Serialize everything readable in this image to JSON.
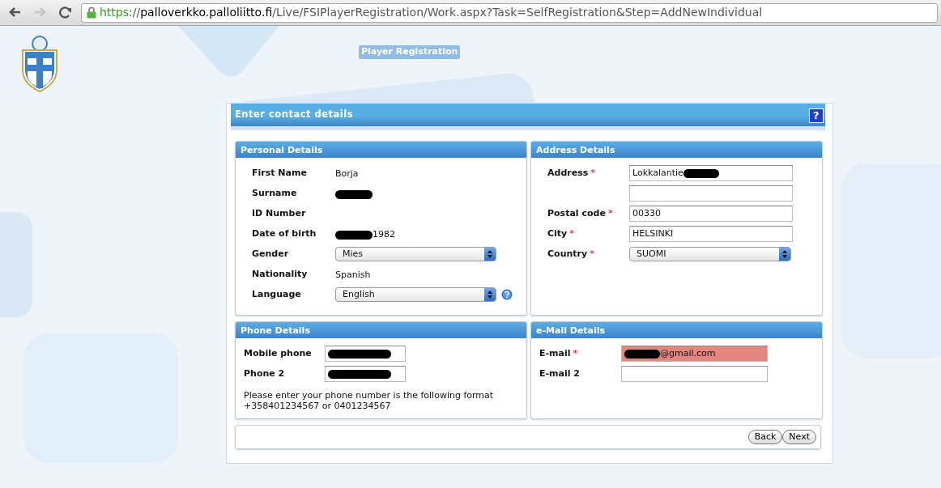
{
  "browser": {
    "nav_buttons": [
      {
        "kind": "back",
        "disabled": false
      },
      {
        "kind": "forward",
        "disabled": true
      },
      {
        "kind": "reload",
        "disabled": false
      }
    ],
    "url": {
      "scheme": "https",
      "separator": "://",
      "host": "palloverkko.palloliitto.fi",
      "path": "/Live/FSIPlayerRegistration/Work.aspx?Task=SelfRegistration&Step=AddNewIndividual"
    }
  },
  "header": {
    "title": "Player Registration"
  },
  "form": {
    "title": "Enter contact details",
    "help_label": "?",
    "sections": [
      {
        "title": "Personal Details",
        "rows": [
          {
            "label": "First Name",
            "kind": "text",
            "value": "Borja"
          },
          {
            "label": "Surname",
            "kind": "text",
            "redacted_before": true
          },
          {
            "label": "ID Number",
            "kind": "text"
          },
          {
            "label": "Date of birth",
            "kind": "text",
            "value": "1982",
            "redacted_before": true
          },
          {
            "label": "Gender",
            "kind": "select",
            "value": "Mies"
          },
          {
            "label": "Nationality",
            "kind": "text",
            "value": "Spanish"
          },
          {
            "label": "Language",
            "kind": "select",
            "value": "English",
            "help": true
          }
        ]
      },
      {
        "title": "Address Details",
        "rows": [
          {
            "label": "Address",
            "required_mark": "*",
            "kind": "input",
            "value": "Lokkalantie",
            "redacted_after": true
          },
          {
            "kind": "input"
          },
          {
            "label": "Postal code",
            "required_mark": "*",
            "kind": "input",
            "value": "00330"
          },
          {
            "label": "City",
            "required_mark": "*",
            "kind": "input",
            "value": "HELSINKI"
          },
          {
            "label": "Country",
            "required_mark": "*",
            "kind": "select",
            "value": "SUOMI"
          }
        ]
      },
      {
        "title": "Phone Details",
        "rows": [
          {
            "label": "Mobile phone",
            "kind": "input",
            "redacted_before": true
          },
          {
            "label": "Phone 2",
            "kind": "input",
            "redacted_before": true
          }
        ],
        "note_lines": [
          "Please enter your phone number is the following format",
          "+358401234567 or 0401234567"
        ]
      },
      {
        "title": "e-Mail Details",
        "rows": [
          {
            "label": "E-mail",
            "required_mark": "*",
            "kind": "input",
            "value": "@gmail.com",
            "redacted_before": true,
            "invalid": true
          },
          {
            "label": "E-mail 2",
            "kind": "input"
          }
        ]
      }
    ],
    "buttons": [
      "Back",
      "Next"
    ]
  }
}
